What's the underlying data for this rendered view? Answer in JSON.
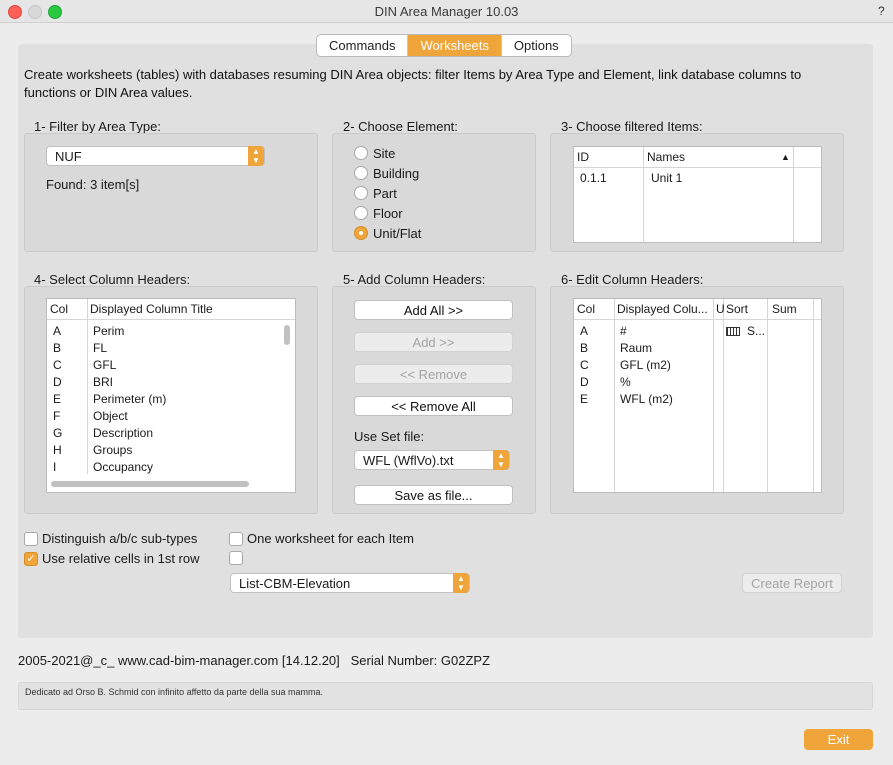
{
  "window": {
    "title": "DIN Area Manager 10.03",
    "help": "?"
  },
  "tabs": [
    {
      "label": "Commands",
      "active": false
    },
    {
      "label": "Worksheets",
      "active": true
    },
    {
      "label": "Options",
      "active": false
    }
  ],
  "description": "Create worksheets (tables) with databases resuming DIN Area objects: filter Items by Area Type and Element, link database columns to functions or DIN Area values.",
  "section1": {
    "title": "1- Filter by Area Type:",
    "area_type": "NUF",
    "found": "Found: 3 item[s]"
  },
  "section2": {
    "title": "2- Choose Element:",
    "options": [
      {
        "label": "Site",
        "selected": false
      },
      {
        "label": "Building",
        "selected": false
      },
      {
        "label": "Part",
        "selected": false
      },
      {
        "label": "Floor",
        "selected": false
      },
      {
        "label": "Unit/Flat",
        "selected": true
      }
    ]
  },
  "section3": {
    "title": "3- Choose filtered Items:",
    "columns": [
      "ID",
      "Names"
    ],
    "rows": [
      {
        "id": "0.1.1",
        "name": "Unit 1"
      }
    ]
  },
  "section4": {
    "title": "4- Select Column Headers:",
    "columns": [
      "Col",
      "Displayed Column Title"
    ],
    "rows": [
      {
        "col": "A",
        "title": "Perim"
      },
      {
        "col": "B",
        "title": "FL"
      },
      {
        "col": "C",
        "title": "GFL"
      },
      {
        "col": "D",
        "title": "BRI"
      },
      {
        "col": "E",
        "title": "Perimeter (m)"
      },
      {
        "col": "F",
        "title": "Object"
      },
      {
        "col": "G",
        "title": "Description"
      },
      {
        "col": "H",
        "title": "Groups"
      },
      {
        "col": "I",
        "title": "Occupancy"
      }
    ]
  },
  "section5": {
    "title": "5- Add Column Headers:",
    "add_all": "Add All >>",
    "add": "Add >>",
    "remove": "<< Remove",
    "remove_all": "<< Remove All",
    "use_set_label": "Use Set file:",
    "set_file": "WFL (WflVo).txt",
    "save_as": "Save as file..."
  },
  "section6": {
    "title": "6- Edit Column Headers:",
    "columns": [
      "Col",
      "Displayed Colu...",
      "U",
      "Sort",
      "Sum"
    ],
    "rows": [
      {
        "col": "A",
        "title": "#",
        "sort": "S..."
      },
      {
        "col": "B",
        "title": "Raum",
        "sort": ""
      },
      {
        "col": "C",
        "title": "GFL (m2)",
        "sort": ""
      },
      {
        "col": "D",
        "title": "%",
        "sort": ""
      },
      {
        "col": "E",
        "title": "WFL (m2)",
        "sort": ""
      }
    ]
  },
  "options": {
    "distinguish": {
      "label": "Distinguish a/b/c sub-types",
      "checked": false
    },
    "relative_cells": {
      "label": "Use relative cells in 1st row",
      "checked": true
    },
    "one_worksheet": {
      "label": "One worksheet for each Item",
      "checked": false
    },
    "extra": {
      "label": "",
      "checked": false
    }
  },
  "report": {
    "template": "List-CBM-Elevation",
    "create": "Create Report"
  },
  "footer": {
    "credits": "2005-2021@_c_ www.cad-bim-manager.com [14.12.20]   Serial Number: G02ZPZ",
    "dedication": "Dedicato ad Orso B. Schmid con infinito affetto da parte della sua mamma.",
    "exit": "Exit"
  },
  "colors": {
    "accent": "#f0a53a"
  }
}
